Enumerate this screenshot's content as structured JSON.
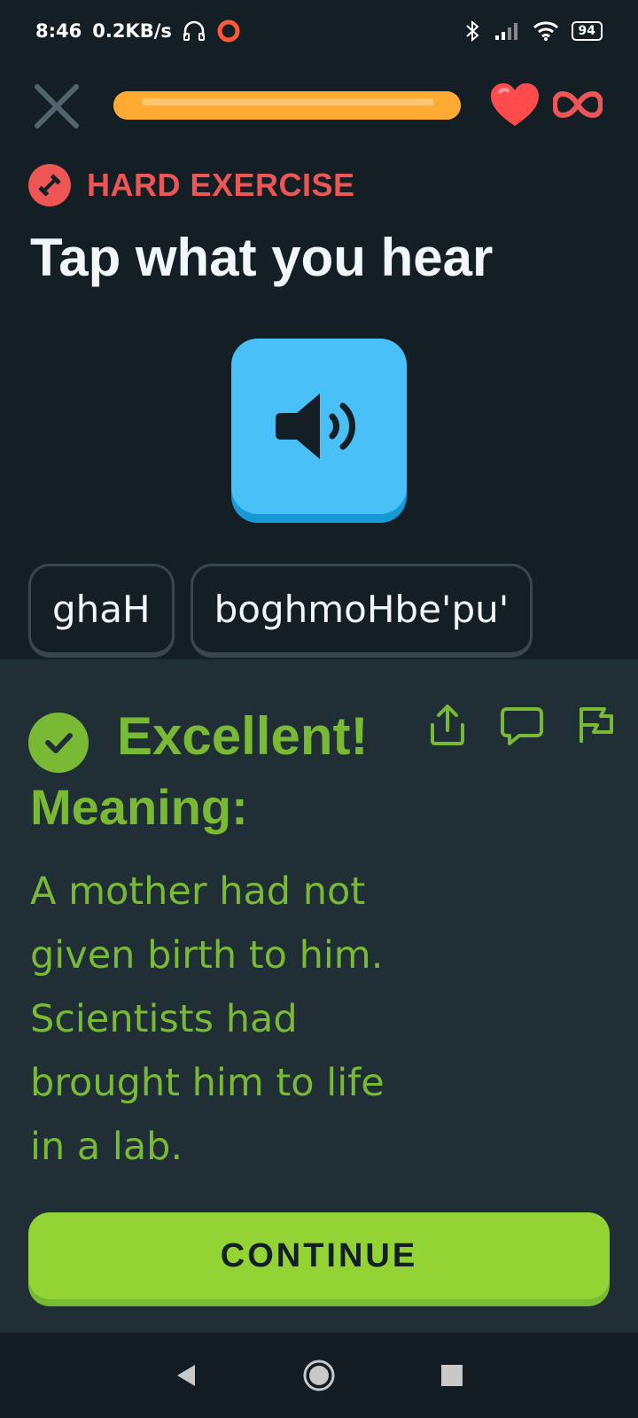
{
  "status_bar": {
    "time": "8:46",
    "net_speed": "0.2KB/s",
    "battery": "94"
  },
  "top_bar": {
    "progress_fraction": 1.0,
    "lives": "∞"
  },
  "exercise": {
    "tag": "HARD EXERCISE",
    "title": "Tap what you hear",
    "words": [
      "ghaH",
      "boghmoHbe'pu'"
    ]
  },
  "feedback": {
    "heading": "Excellent!",
    "meaning_label": "Meaning:",
    "meaning_lines": [
      "A mother had not",
      "given birth to him.",
      "Scientists had",
      "brought him to life",
      "in a lab."
    ],
    "continue_label": "CONTINUE"
  },
  "colors": {
    "background": "#131f24",
    "feedback_bg": "#202f36",
    "success_green": "#79b933",
    "button_green": "#93d333",
    "progress_orange": "#ffab33",
    "audio_blue": "#49c0f8",
    "hard_red": "#ee5555"
  }
}
